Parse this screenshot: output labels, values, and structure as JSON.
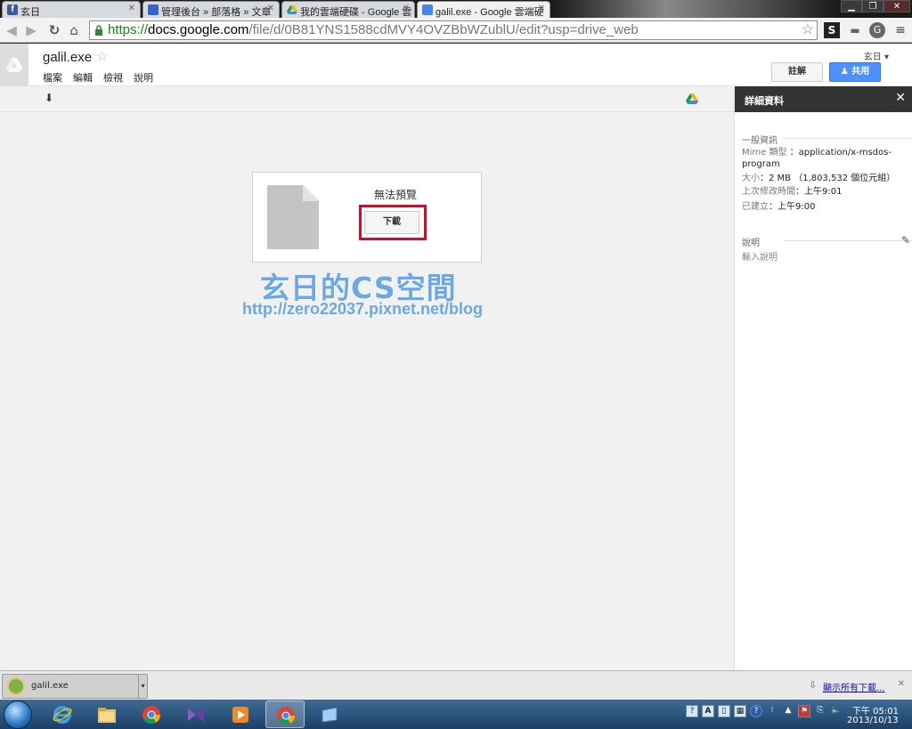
{
  "tabs": [
    {
      "title": "玄日",
      "icon_color": "#3b5998"
    },
    {
      "title": "管理後台 » 部落格 » 文章",
      "icon_color": "#3366cc"
    },
    {
      "title": "我的雲端硬碟 - Google 雲",
      "icon_color": "#f4b400"
    },
    {
      "title": "galil.exe - Google 雲端硬",
      "icon_color": "#4285f4"
    }
  ],
  "address_bar": {
    "scheme": "https://",
    "host": "docs.google.com",
    "path": "/file/d/0B81YNS1588cdMVY4OVZBbWZublU/edit?usp=drive_web"
  },
  "drive": {
    "doc_title": "galil.exe",
    "menu": [
      "檔案",
      "編輯",
      "檢視",
      "說明"
    ],
    "user_name": "玄日 ▾",
    "comment_label": "註解",
    "share_label": "共用"
  },
  "viewer": {
    "no_preview_text": "無法預覽",
    "download_label": "下載",
    "watermark_title": "玄日的CS空間",
    "watermark_url": "http://zero22037.pixnet.net/blog"
  },
  "details": {
    "title": "詳細資料",
    "general_section": "一般資訊",
    "mime_label": "Mime 類型",
    "mime_value": "application/x-msdos-program",
    "size_label": "大小",
    "size_value": "2 MB （1,803,532 個位元組）",
    "modified_label": "上次修改時間",
    "modified_value": "上午9:01",
    "created_label": "已建立",
    "created_value": "上午9:00",
    "description_section": "說明",
    "description_placeholder": "輸入說明"
  },
  "download_shelf": {
    "file_name": "galil.exe",
    "show_all_label": "顯示所有下載..."
  },
  "taskbar": {
    "clock_time": "下午 05:01",
    "clock_date": "2013/10/13"
  },
  "colors": {
    "share_blue": "#4d90fe",
    "highlight_red": "#c8102e",
    "watermark_blue": "#6aa8e8",
    "https_green": "#118a11"
  }
}
